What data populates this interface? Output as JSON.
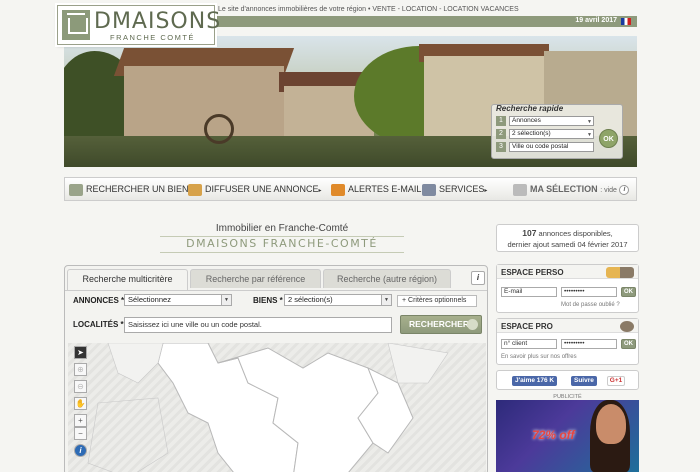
{
  "header": {
    "logo_title": "DMAISONS",
    "logo_sub": "FRANCHE COMTÉ",
    "tagline": "Le site d'annonces immobilières de votre région • VENTE - LOCATION - LOCATION VACANCES",
    "date": "19 avril 2017",
    "accent": "#8e9a7c"
  },
  "quick_search": {
    "title": "Recherche rapide",
    "rows": [
      {
        "num": "1",
        "value": "Annonces"
      },
      {
        "num": "2",
        "value": "2 sélection(s)"
      },
      {
        "num": "3",
        "value": "Ville ou code postal"
      }
    ],
    "ok": "OK"
  },
  "nav": {
    "items": [
      {
        "label": "RECHERCHER UN BIEN",
        "icon": "house-icon"
      },
      {
        "label": "DIFFUSER UNE ANNONCE",
        "icon": "megaphone-icon"
      },
      {
        "label": "ALERTES E-MAIL",
        "icon": "email-alert-icon"
      },
      {
        "label": "SERVICES",
        "icon": "services-icon"
      }
    ],
    "selection_label": "MA SÉLECTION",
    "selection_state": ": vide"
  },
  "heading": {
    "immo": "Immobilier en Franche-Comté",
    "brand": "DMAISONS FRANCHE-COMTÉ"
  },
  "search": {
    "tabs": [
      "Recherche multicritère",
      "Recherche par référence",
      "Recherche (autre région)"
    ],
    "annonces_label": "ANNONCES *",
    "annonces_value": "Sélectionnez",
    "biens_label": "BIENS *",
    "biens_value": "2 sélection(s)",
    "criteres": "+ Critères optionnels",
    "localites_label": "LOCALITÉS *",
    "localites_placeholder": "Saisissez ici une ville ou un code postal.",
    "button": "RECHERCHER"
  },
  "dispo": {
    "count": "107",
    "line1_rest": " annonces disponibles,",
    "line2": "dernier ajout samedi 04 février 2017"
  },
  "espace_perso": {
    "title": "ESPACE PERSO",
    "email_placeholder": "E-mail",
    "password_mask": "•••••••••",
    "ok": "OK",
    "forgot": "Mot de passe oublié ?"
  },
  "espace_pro": {
    "title": "ESPACE PRO",
    "client_placeholder": "n° client",
    "password_mask": "•••••••••",
    "ok": "OK",
    "more": "En savoir plus sur nos offres"
  },
  "social": {
    "like": "J'aime 176 K",
    "follow": "Suivre",
    "gplus": "G+1"
  },
  "pub": {
    "label": "PUBLICITÉ",
    "offer": "72% off"
  }
}
